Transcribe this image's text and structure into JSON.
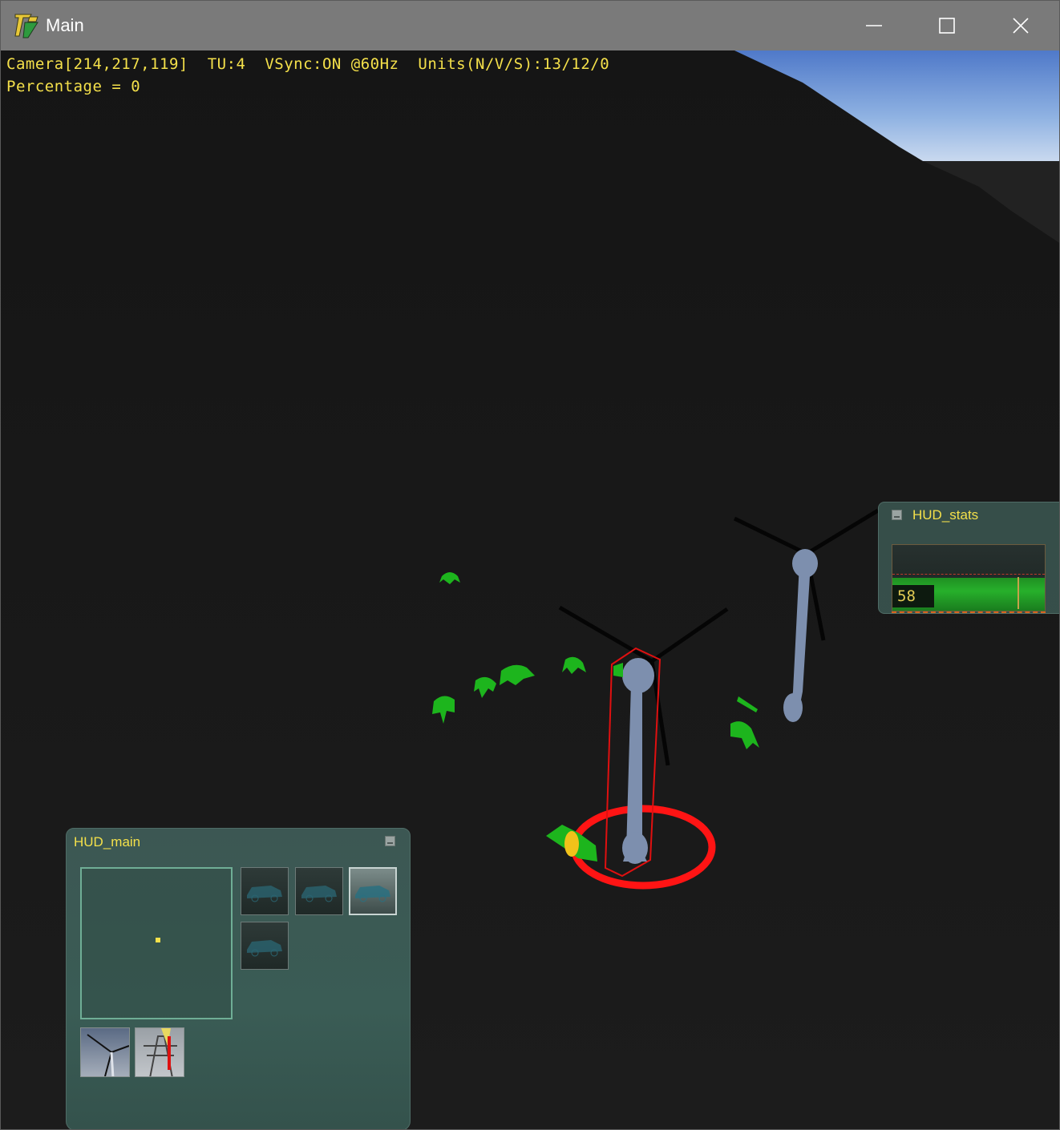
{
  "window": {
    "title": "Main",
    "controls": [
      "minimize",
      "maximize",
      "close"
    ]
  },
  "osd": {
    "line1": "Camera[214,217,119]  TU:4  VSync:ON @60Hz  Units(N/V/S):13/12/0",
    "line2": "Percentage = 0"
  },
  "hud_stats": {
    "title": "HUD_stats",
    "value": "58",
    "fill_fraction": 0.5,
    "marker_fraction": 0.82
  },
  "hud_main": {
    "title": "HUD_main",
    "unit_slots": [
      {
        "icon": "vehicle-icon",
        "selected": false
      },
      {
        "icon": "vehicle-icon",
        "selected": false
      },
      {
        "icon": "vehicle-icon",
        "selected": true
      },
      {
        "icon": "vehicle-icon",
        "selected": false
      }
    ],
    "build_slots": [
      {
        "icon": "wind-turbine-icon"
      },
      {
        "icon": "power-pylon-icon"
      }
    ]
  },
  "colors": {
    "osd_text": "#f4e04a",
    "unit_green": "#1db51d",
    "selection_red": "#ff1414",
    "turbine_blue": "#7d8fae",
    "hud_panel": "#3a544e"
  }
}
